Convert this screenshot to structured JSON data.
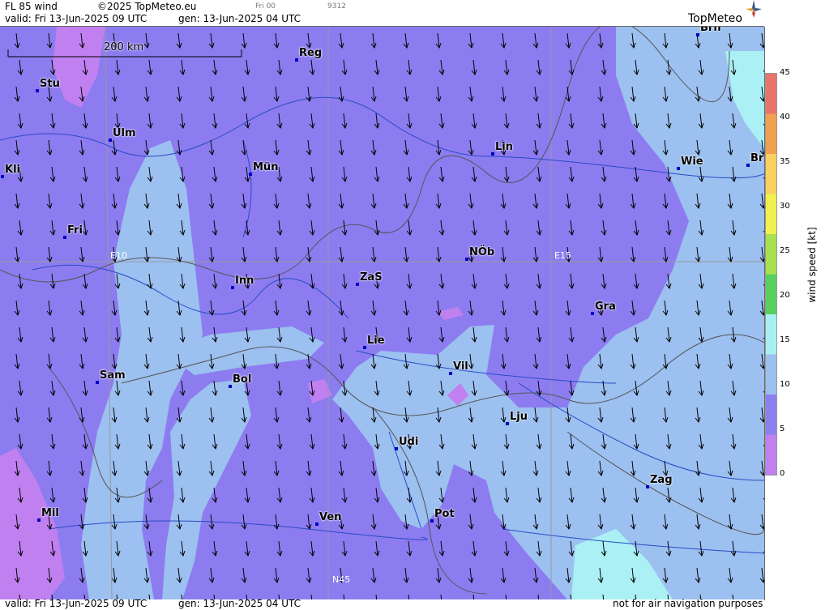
{
  "header": {
    "title": "FL 85 wind",
    "copyright": "©2025 TopMeteo.eu",
    "run": "Fri 00",
    "code": "9312",
    "valid": "valid:  Fri  13-Jun-2025  09 UTC",
    "gen": "gen: 13-Jun-2025 04 UTC",
    "logo": "TopMeteo"
  },
  "footer": {
    "valid": "valid:  Fri  13-Jun-2025  09 UTC",
    "gen": "gen: 13-Jun-2025 04 UTC",
    "note": "not for air navigation purposes"
  },
  "map": {
    "scale_label": "200 km",
    "grid_labels": [
      "E10",
      "E15",
      "N45"
    ],
    "cities": [
      "Brn",
      "Reg",
      "Stu",
      "Ulm",
      "Kli",
      "Mün",
      "Lin",
      "Wie",
      "Br",
      "Fri",
      "NÖb",
      "Inn",
      "ZaS",
      "Gra",
      "Lie",
      "Vil",
      "Sam",
      "Bol",
      "Lju",
      "Udi",
      "Zag",
      "Mil",
      "Ven",
      "Pot"
    ]
  },
  "legend": {
    "title": "wind speed [kt]",
    "ticks": [
      "45",
      "40",
      "35",
      "30",
      "25",
      "20",
      "15",
      "10",
      "5",
      "0"
    ],
    "colors": [
      "#e8736b",
      "#f0a050",
      "#f8d060",
      "#f0f050",
      "#a8e050",
      "#58d060",
      "#a8f0f0",
      "#9cc0f0",
      "#8c80f0",
      "#c080f0"
    ]
  }
}
